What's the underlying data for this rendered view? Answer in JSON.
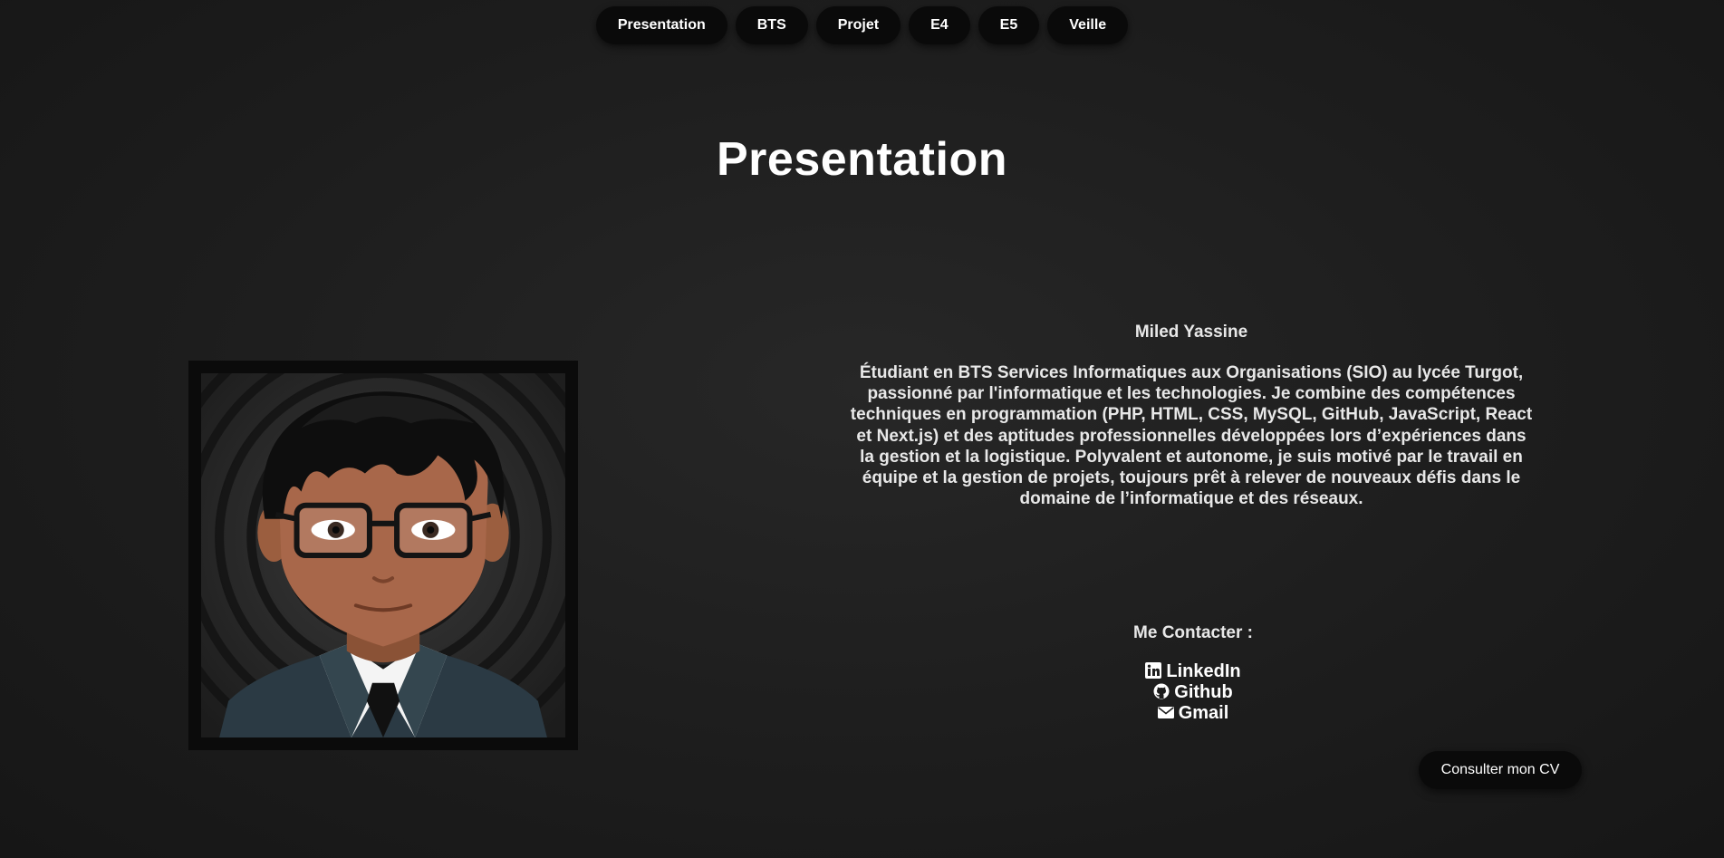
{
  "nav": {
    "items": [
      {
        "label": "Presentation"
      },
      {
        "label": "BTS"
      },
      {
        "label": "Projet"
      },
      {
        "label": "E4"
      },
      {
        "label": "E5"
      },
      {
        "label": "Veille"
      }
    ]
  },
  "page": {
    "title": "Presentation"
  },
  "profile": {
    "name": "Miled Yassine",
    "bio": "Étudiant en BTS Services Informatiques aux Organisations (SIO) au lycée Turgot, passionné par l'informatique et les technologies. Je combine des compétences techniques en programmation (PHP, HTML, CSS, MySQL, GitHub, JavaScript, React et Next.js) et des aptitudes professionnelles développées lors d’expériences dans la gestion et la logistique. Polyvalent et autonome, je suis motivé par le travail en équipe et la gestion de projets, toujours prêt à relever de nouveaux défis dans le domaine de l’informatique et des réseaux.",
    "avatar_icon": "cartoon-avatar"
  },
  "contact": {
    "title": "Me Contacter :",
    "links": [
      {
        "label": "LinkedIn",
        "icon": "linkedin-icon"
      },
      {
        "label": "Github",
        "icon": "github-icon"
      },
      {
        "label": "Gmail",
        "icon": "mail-icon"
      }
    ]
  },
  "actions": {
    "cv_label": "Consulter mon CV"
  },
  "colors": {
    "background": "#1f1f1f",
    "button": "#0a0a0a",
    "text": "#ffffff"
  }
}
